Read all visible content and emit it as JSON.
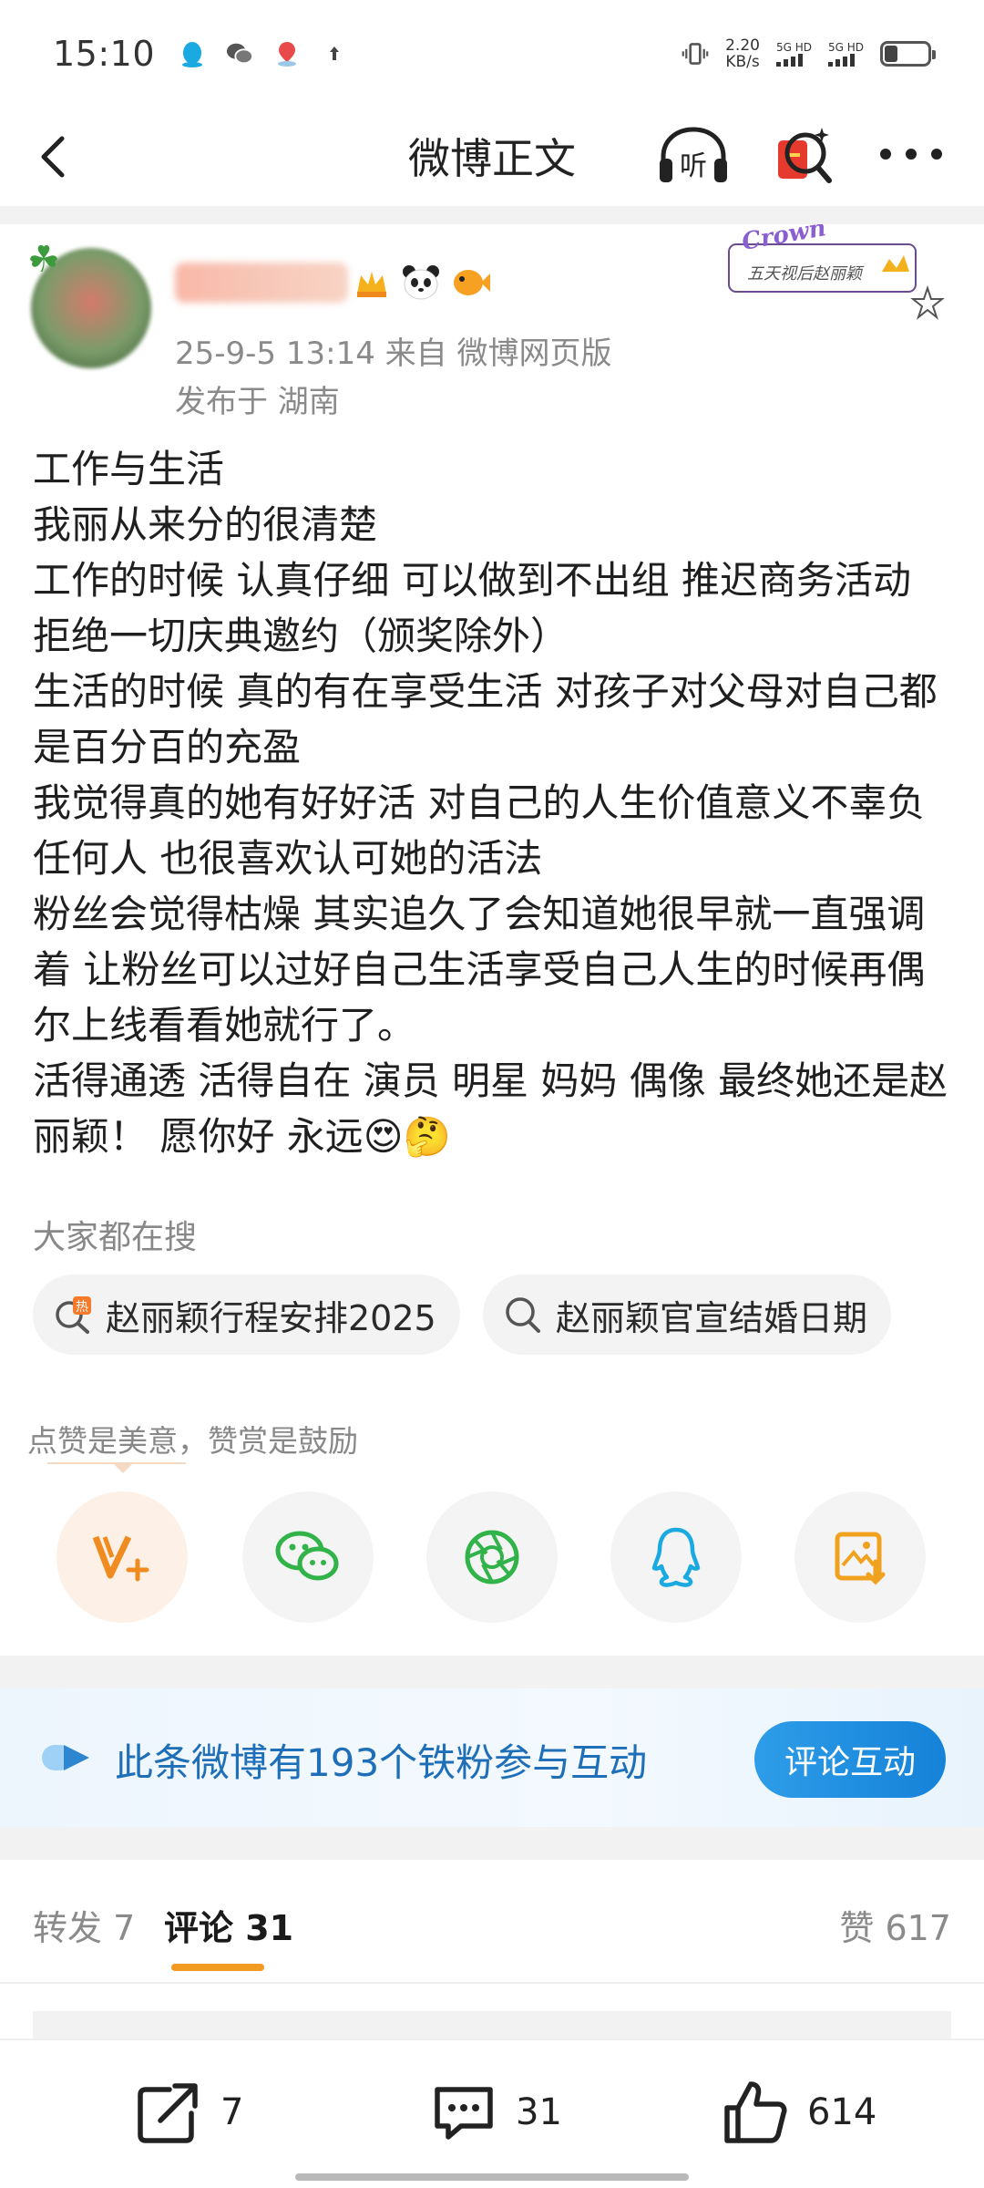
{
  "status_bar": {
    "time": "15:10",
    "net_speed_value": "2.20",
    "net_speed_unit": "KB/s",
    "sim1": "5G HD",
    "sim2": "5G HD",
    "battery_level": 0.3,
    "icons": [
      "qq-icon",
      "wechat-icon",
      "map-pin-icon",
      "upload-arrow-icon",
      "vibrate-icon",
      "signal-icon",
      "battery-icon"
    ]
  },
  "nav": {
    "title": "微博正文",
    "listen_label": "听"
  },
  "post": {
    "meta_time_source": "25-9-5 13:14  来自 微博网页版",
    "meta_location": "发布于 湖南",
    "stamp_word": "Crown",
    "stamp_text": "五天视后赵丽颖",
    "body_lines": [
      "工作与生活",
      "我丽从来分的很清楚",
      "工作的时候 认真仔细 可以做到不出组 推迟商务活动 拒绝一切庆典邀约（颁奖除外）",
      "生活的时候 真的有在享受生活 对孩子对父母对自己都是百分百的充盈",
      "我觉得真的她有好好活  对自己的人生价值意义不辜负任何人  也很喜欢认可她的活法",
      "粉丝会觉得枯燥  其实追久了会知道她很早就一直强调着 让粉丝可以过好自己生活享受自己人生的时候再偶尔上线看看她就行了。",
      "活得通透 活得自在 演员 明星 妈妈 偶像 最终她还是赵丽颖！  愿你好 永远😍🤔"
    ]
  },
  "search": {
    "label": "大家都在搜",
    "chips": [
      {
        "text": "赵丽颖行程安排2025",
        "icon": "hot-search-icon"
      },
      {
        "text": "赵丽颖官宣结婚日期",
        "icon": "search-icon"
      }
    ]
  },
  "reward": {
    "label": "点赞是美意，赞赏是鼓励"
  },
  "fan_banner": {
    "text": "此条微博有193个铁粉参与互动",
    "button": "评论互动"
  },
  "tabs": {
    "repost": "转发 7",
    "comment": "评论 31",
    "likes": "赞 617"
  },
  "bottom_bar": {
    "repost_count": "7",
    "comment_count": "31",
    "like_count": "614"
  },
  "colors": {
    "accent_orange": "#f29a21",
    "banner_blue": "#1e6fb8",
    "button_blue": "#1582d8",
    "wechat_green": "#31b34a",
    "qq_blue": "#1aa9e0"
  }
}
